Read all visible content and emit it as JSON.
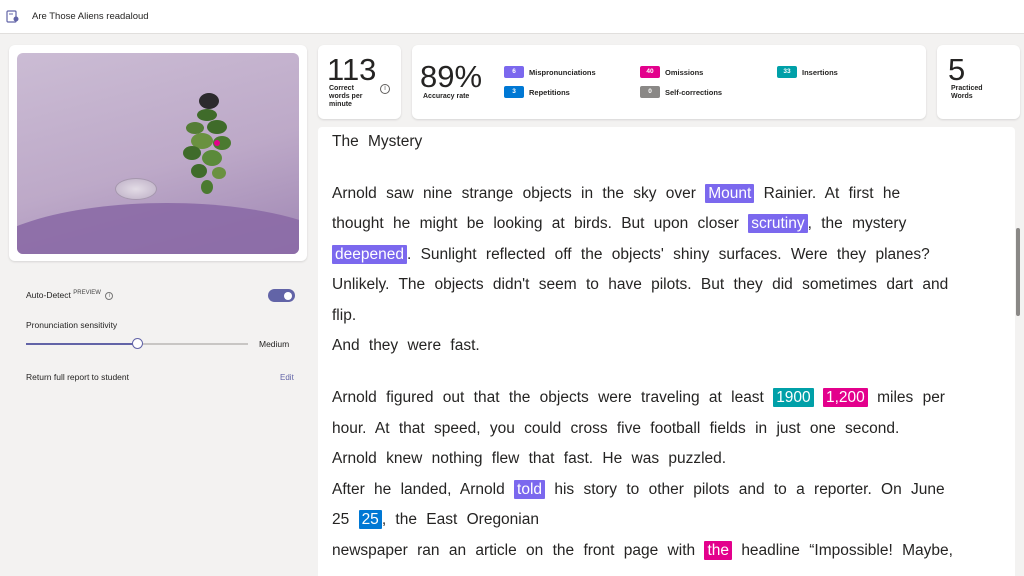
{
  "app": {
    "title": "Are Those Aliens readaloud"
  },
  "settings": {
    "auto_detect_label": "Auto-Detect",
    "preview_tag": "PREVIEW",
    "sensitivity_label": "Pronunciation sensitivity",
    "sensitivity_value": "Medium",
    "sensitivity_level": 0.5,
    "return_report_label": "Return full report to student",
    "edit_label": "Edit"
  },
  "stats": {
    "cwpm_value": "113",
    "cwpm_label": "Correct words per minute",
    "accuracy_value": "89%",
    "accuracy_label": "Accuracy rate",
    "practiced_value": "5",
    "practiced_label": "Practiced Words",
    "errors": {
      "mispronunciations": {
        "count": "6",
        "label": "Mispronunciations",
        "color": "#7b68ee"
      },
      "repetitions": {
        "count": "3",
        "label": "Repetitions",
        "color": "#0078d4"
      },
      "omissions": {
        "count": "40",
        "label": "Omissions",
        "color": "#e3008c"
      },
      "self_corrections": {
        "count": "0",
        "label": "Self-corrections",
        "color": "#8a8886"
      },
      "insertions": {
        "count": "33",
        "label": "Insertions",
        "color": "#00a0a8"
      }
    }
  },
  "reading": {
    "title": "The Mystery",
    "p1l1a": "Arnold saw nine strange objects in the sky over",
    "p1l1h": "Mount",
    "p1l1b": "Rainier. At first he",
    "p1l2a": "thought he might be looking at birds. But upon closer",
    "p1l2h": "scrutiny",
    "p1l2b": ", the mystery",
    "p1l3h": "deepened",
    "p1l3b": ". Sunlight reflected off the objects' shiny surfaces. Were they planes?",
    "p1l4": "Unlikely. The objects didn't seem to have pilots. But they did sometimes dart and",
    "p1l5": "flip.",
    "p1l6": "And they were fast.",
    "p2l1a": "Arnold figured out that the objects were traveling at least",
    "p2l1h1": "1900",
    "p2l1h2": "1,200",
    "p2l1b": "miles per",
    "p2l2": "hour. At that speed, you could cross five football fields in just one second.",
    "p2l3": "Arnold knew nothing flew that fast. He was puzzled.",
    "p2l4a": "After he landed, Arnold",
    "p2l4h": "told",
    "p2l4b": "his story to other pilots and to a reporter. On June",
    "p2l5a": "25",
    "p2l5h": "25",
    "p2l5b": ", the East Oregonian",
    "p2l6a": "newspaper ran an article on the front page with",
    "p2l6h": "the",
    "p2l6b": "headline “Impossible! Maybe,"
  }
}
